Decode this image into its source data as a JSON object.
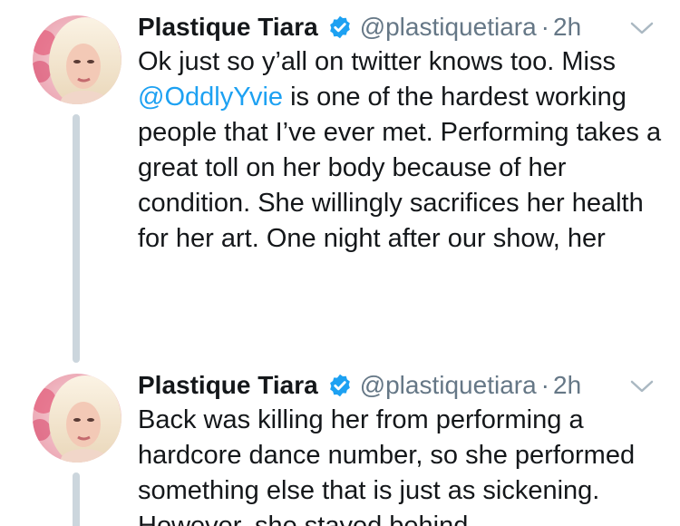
{
  "colors": {
    "text_primary": "#14171a",
    "text_secondary": "#657786",
    "link": "#1da1f2",
    "verified": "#1da1f2",
    "thread_line": "#ccd6dd"
  },
  "tweets": [
    {
      "display_name": "Plastique Tiara",
      "handle": "@plastiquetiara",
      "separator": "·",
      "time": "2h",
      "verified": true,
      "avatar_icon": "profile-photo-avatar",
      "menu_icon": "chevron-down-icon",
      "text_before": "Ok just so y’all on twitter knows too. Miss ",
      "mention": "@OddlyYvie",
      "text_after": " is one of the hardest working people that I’ve ever met. Performing takes a great toll on her body because of her condition. She willingly sacrifices her health for her art. One night after our show, her"
    },
    {
      "display_name": "Plastique Tiara",
      "handle": "@plastiquetiara",
      "separator": "·",
      "time": "2h",
      "verified": true,
      "avatar_icon": "profile-photo-avatar",
      "menu_icon": "chevron-down-icon",
      "text": "Back was killing her from performing a hardcore dance number, so she performed something else that is just as sickening. However, she stayed behind"
    }
  ]
}
